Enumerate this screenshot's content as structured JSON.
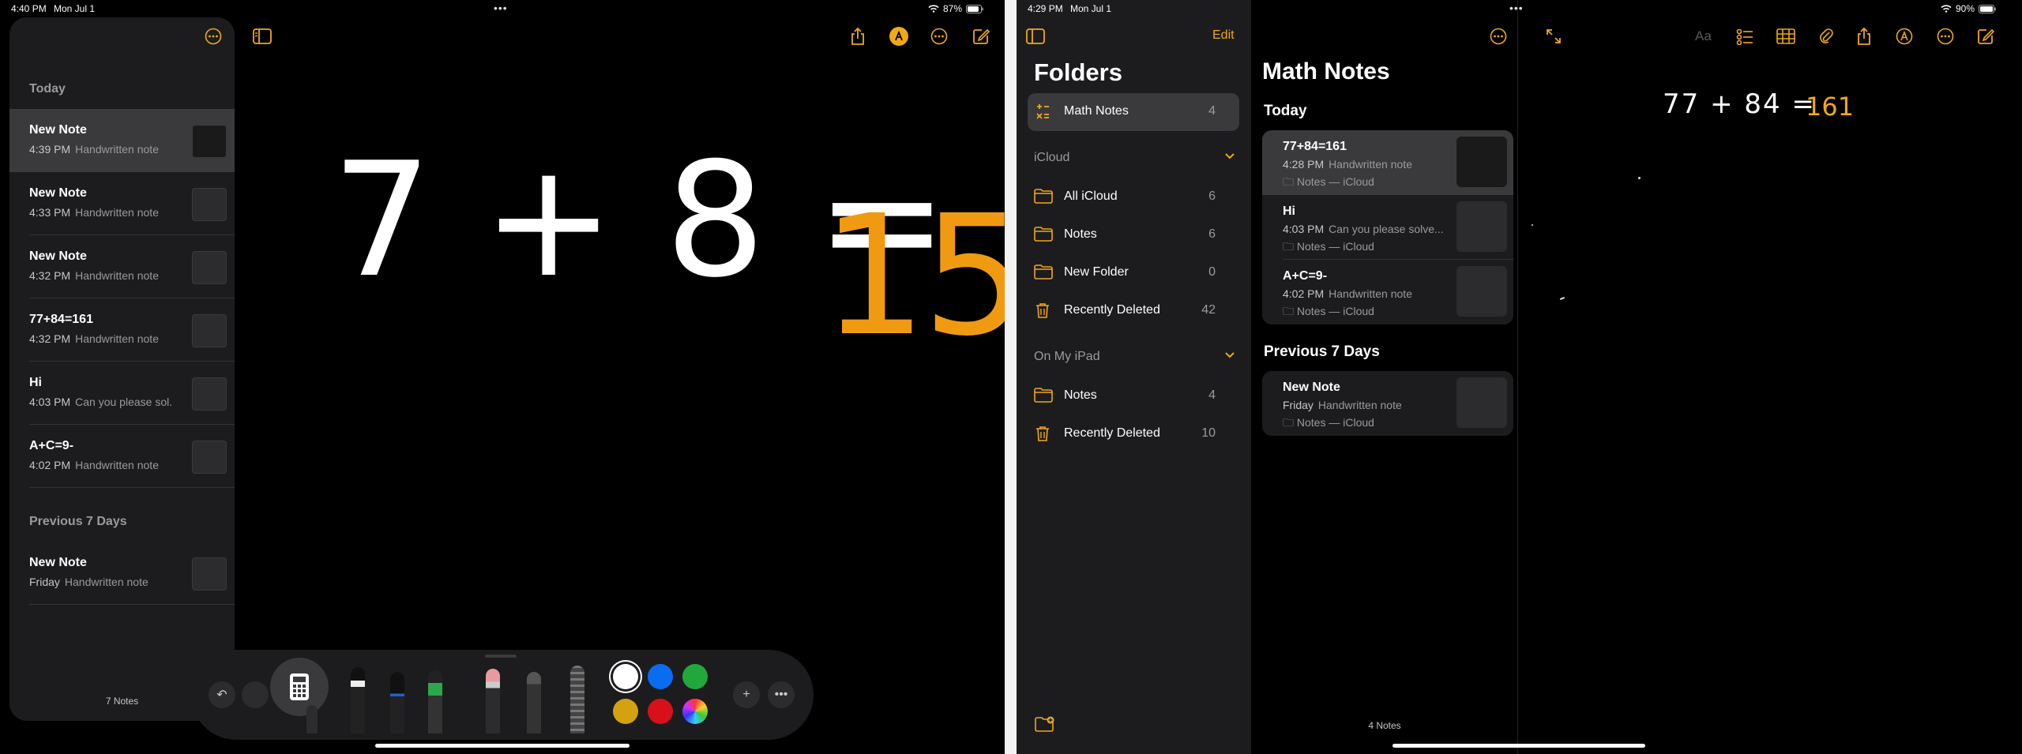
{
  "left": {
    "status": {
      "time": "4:40 PM",
      "date": "Mon Jul 1",
      "battery": "87%"
    },
    "sidebar": {
      "sections": [
        {
          "heading": "Today"
        },
        {
          "heading": "Previous 7 Days"
        }
      ],
      "notes": [
        {
          "title": "New Note",
          "time": "4:39 PM",
          "preview": "Handwritten note"
        },
        {
          "title": "New Note",
          "time": "4:33 PM",
          "preview": "Handwritten note"
        },
        {
          "title": "New Note",
          "time": "4:32 PM",
          "preview": "Handwritten note"
        },
        {
          "title": "77+84=161",
          "time": "4:32 PM",
          "preview": "Handwritten note"
        },
        {
          "title": "Hi",
          "time": "4:03 PM",
          "preview": "Can you please sol..."
        },
        {
          "title": "A+C=9-",
          "time": "4:02 PM",
          "preview": "Handwritten note"
        },
        {
          "title": "New Note",
          "time": "Friday",
          "preview": "Handwritten note"
        }
      ],
      "count": "7 Notes"
    },
    "canvas": {
      "expr_left": "7 + 8 =",
      "result": "15"
    },
    "colors": {
      "accent": "#f0a817",
      "result": "#f09a12"
    },
    "palette": [
      "#ffffff",
      "#0a6cf0",
      "#22a83a",
      "#d4a20e",
      "#d8101a"
    ]
  },
  "right": {
    "status": {
      "time": "4:29 PM",
      "date": "Mon Jul 1",
      "battery": "90%"
    },
    "folders": {
      "title": "Folders",
      "edit": "Edit",
      "pinned": {
        "name": "Math Notes",
        "count": "4"
      },
      "icloud_heading": "iCloud",
      "icloud": [
        {
          "name": "All iCloud",
          "count": "6"
        },
        {
          "name": "Notes",
          "count": "6"
        },
        {
          "name": "New Folder",
          "count": "0"
        },
        {
          "name": "Recently Deleted",
          "count": "42"
        }
      ],
      "ipad_heading": "On My iPad",
      "ipad": [
        {
          "name": "Notes",
          "count": "4"
        },
        {
          "name": "Recently Deleted",
          "count": "10"
        }
      ]
    },
    "list": {
      "title": "Math Notes",
      "today": "Today",
      "prev": "Previous 7 Days",
      "today_notes": [
        {
          "title": "77+84=161",
          "time": "4:28 PM",
          "preview": "Handwritten note",
          "folder": "Notes — iCloud"
        },
        {
          "title": "Hi",
          "time": "4:03 PM",
          "preview": "Can you please solve...",
          "folder": "Notes — iCloud"
        },
        {
          "title": "A+C=9-",
          "time": "4:02 PM",
          "preview": "Handwritten note",
          "folder": "Notes — iCloud"
        }
      ],
      "prev_notes": [
        {
          "title": "New Note",
          "time": "Friday",
          "preview": "Handwritten note",
          "folder": "Notes — iCloud"
        }
      ],
      "count": "4 Notes"
    },
    "canvas": {
      "expr_left": "77 + 84 =",
      "result": "161",
      "text_format": "Aa"
    }
  }
}
